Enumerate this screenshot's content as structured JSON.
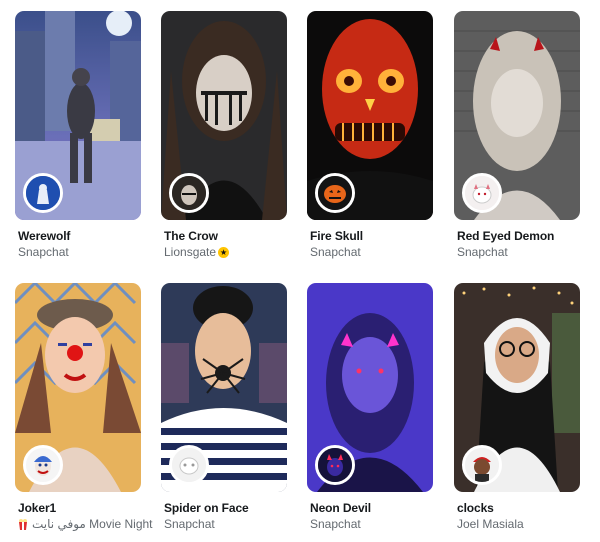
{
  "lenses": [
    {
      "title": "Werewolf",
      "creator": "Snapchat",
      "icon": "werewolf-icon"
    },
    {
      "title": "The Crow",
      "creator": "Lionsgate",
      "verified": true,
      "icon": "crow-face-icon"
    },
    {
      "title": "Fire Skull",
      "creator": "Snapchat",
      "icon": "pumpkin-icon"
    },
    {
      "title": "Red Eyed Demon",
      "creator": "Snapchat",
      "icon": "ghost-cat-icon"
    },
    {
      "title": "Joker1",
      "creator": "موفي نايت Movie Night",
      "creator_emoji": "popcorn-icon",
      "icon": "clown-icon"
    },
    {
      "title": "Spider on Face",
      "creator": "Snapchat",
      "icon": "mask-face-icon"
    },
    {
      "title": "Neon Devil",
      "creator": "Snapchat",
      "icon": "neon-devil-icon"
    },
    {
      "title": "clocks",
      "creator": "Joel Masiala",
      "icon": "avatar-icon"
    }
  ]
}
